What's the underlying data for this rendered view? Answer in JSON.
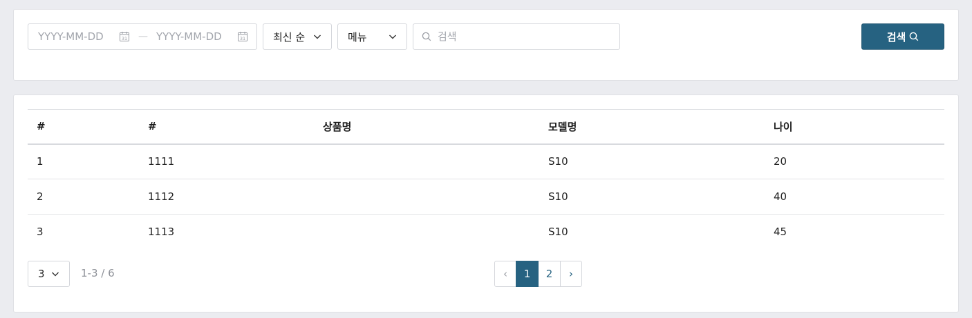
{
  "filters": {
    "date_start_placeholder": "YYYY-MM-DD",
    "date_end_placeholder": "YYYY-MM-DD",
    "range_separator": "—",
    "sort_selected": "최신 순",
    "menu_selected": "메뉴",
    "search_placeholder": "검색",
    "search_button_label": "검색",
    "calendar_icon_day": "31"
  },
  "table": {
    "headers": [
      "#",
      "#",
      "상품명",
      "모델명",
      "나이"
    ],
    "rows": [
      [
        "1",
        "1111",
        "",
        "S10",
        "20"
      ],
      [
        "2",
        "1112",
        "",
        "S10",
        "40"
      ],
      [
        "3",
        "1113",
        "",
        "S10",
        "45"
      ]
    ]
  },
  "pagination": {
    "page_size": "3",
    "range_text": "1-3 / 6",
    "prev_label": "‹",
    "next_label": "›",
    "pages": [
      "1",
      "2"
    ],
    "current_page": "1"
  },
  "colors": {
    "accent": "#266281",
    "background": "#ebecf0"
  },
  "icons": [
    "calendar-icon",
    "chevron-down-icon",
    "search-icon"
  ]
}
